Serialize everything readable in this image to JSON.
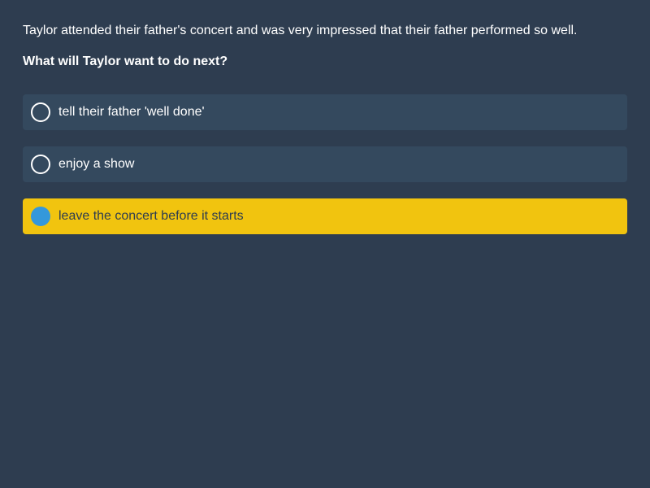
{
  "context": "Taylor attended their father's concert and was very impressed that their father performed so well.",
  "question": "What will Taylor want to do next?",
  "options": [
    {
      "label": "tell their father 'well done'",
      "selected": false
    },
    {
      "label": "enjoy a show",
      "selected": false
    },
    {
      "label": "leave the concert before it starts",
      "selected": true
    }
  ],
  "colors": {
    "background": "#2e3d50",
    "option_background": "#34495e",
    "selected_background": "#f1c40f",
    "selected_radio": "#3498db"
  },
  "icons": {
    "unselected": "radio-unselected-icon",
    "selected": "radio-selected-icon"
  }
}
